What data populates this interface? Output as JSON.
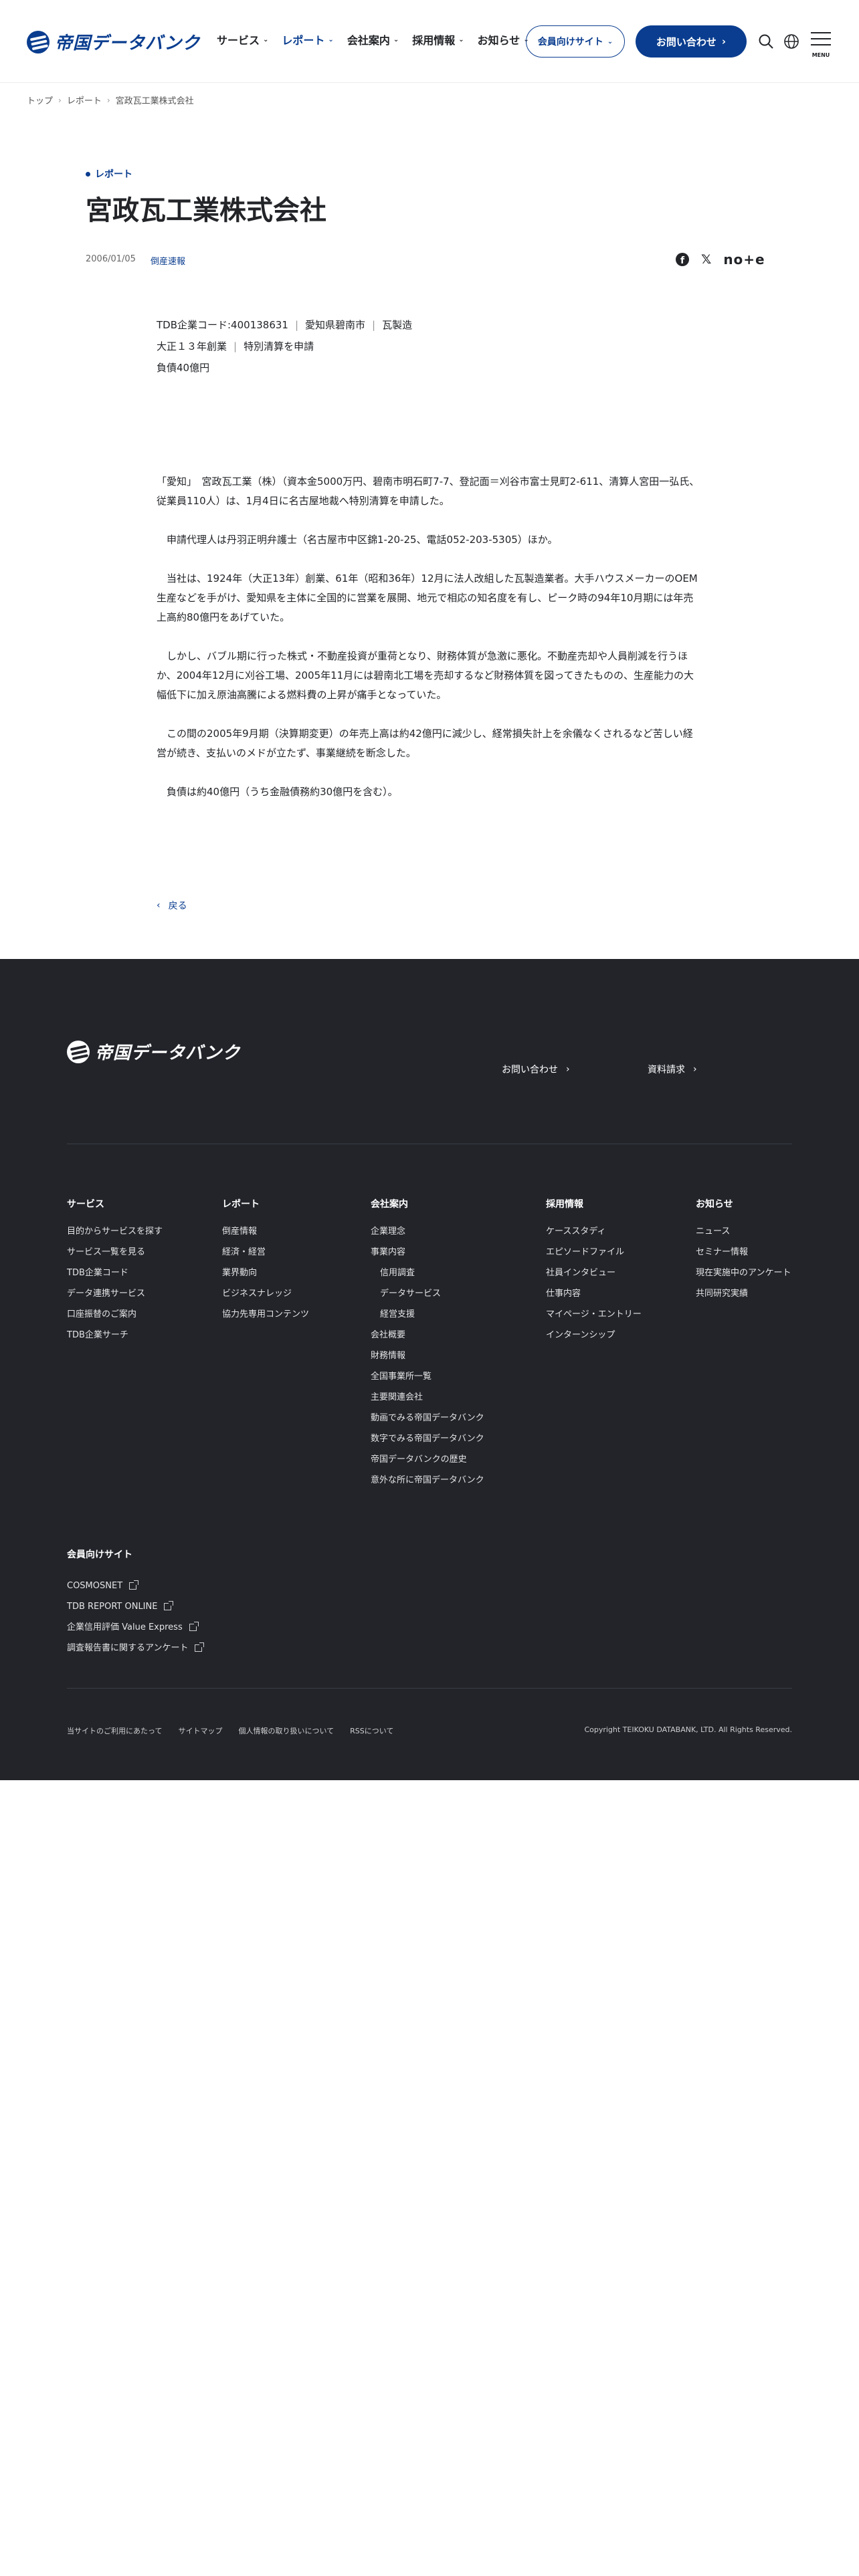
{
  "header": {
    "logo_text": "帝国データバンク",
    "nav": [
      "サービス",
      "レポート",
      "会社案内",
      "採用情報",
      "お知らせ"
    ],
    "active_nav": "レポート",
    "member_site_label": "会員向けサイト",
    "contact_label": "お問い合わせ",
    "menu_label": "MENU",
    "accent_color": "#0a3d8f"
  },
  "breadcrumb": [
    "トップ",
    "レポート",
    "宮政瓦工業株式会社"
  ],
  "article": {
    "category": "レポート",
    "title": "宮政瓦工業株式会社",
    "date": "2006/01/05",
    "tag": "倒産速報",
    "share": [
      "facebook-icon",
      "x-icon",
      "note-icon"
    ],
    "info_lines": [
      [
        "TDB企業コード:400138631",
        "愛知県碧南市",
        "瓦製造"
      ],
      [
        "大正１３年創業",
        "特別清算を申請"
      ],
      [
        "負債40億円"
      ]
    ],
    "paragraphs": [
      "「愛知」　宮政瓦工業（株）（資本金5000万円、碧南市明石町7-7、登記面＝刈谷市富士見町2-611、清算人宮田一弘氏、従業員110人）は、1月4日に名古屋地裁へ特別清算を申請した。",
      "　申請代理人は丹羽正明弁護士（名古屋市中区錦1-20-25、電話052-203-5305）ほか。",
      "　当社は、1924年（大正13年）創業、61年（昭和36年）12月に法人改組した瓦製造業者。大手ハウスメーカーのOEM生産などを手がけ、愛知県を主体に全国的に営業を展開、地元で相応の知名度を有し、ピーク時の94年10月期には年売上高約80億円をあげていた。",
      "　しかし、バブル期に行った株式・不動産投資が重荷となり、財務体質が急激に悪化。不動産売却や人員削減を行うほか、2004年12月に刈谷工場、2005年11月には碧南北工場を売却するなど財務体質を図ってきたものの、生産能力の大幅低下に加え原油高騰による燃料費の上昇が痛手となっていた。",
      "　この間の2005年9月期（決算期変更）の年売上高は約42億円に減少し、経常損失計上を余儀なくされるなど苦しい経営が続き、支払いのメドが立たず、事業継続を断念した。",
      "　負債は約40億円（うち金融債務約30億円を含む）。"
    ],
    "back_label": "戻る"
  },
  "footer": {
    "logo_text": "帝国データバンク",
    "top_links": [
      "お問い合わせ",
      "資料請求"
    ],
    "columns": [
      {
        "heading": "サービス",
        "items": [
          "目的からサービスを探す",
          "サービス一覧を見る",
          "TDB企業コード",
          "データ連携サービス",
          "口座振替のご案内",
          "TDB企業サーチ"
        ]
      },
      {
        "heading": "レポート",
        "items": [
          "倒産情報",
          "経済・経営",
          "業界動向",
          "ビジネスナレッジ",
          "協力先専用コンテンツ"
        ]
      },
      {
        "heading": "会社案内",
        "items": [
          "企業理念",
          "事業内容",
          "信用調査",
          "データサービス",
          "経営支援",
          "会社概要",
          "財務情報",
          "全国事業所一覧",
          "主要関連会社",
          "動画でみる帝国データバンク",
          "数字でみる帝国データバンク",
          "帝国データバンクの歴史",
          "意外な所に帝国データバンク"
        ]
      },
      {
        "heading": "採用情報",
        "items": [
          "ケーススタディ",
          "エピソードファイル",
          "社員インタビュー",
          "仕事内容",
          "マイページ・エントリー",
          "インターンシップ"
        ]
      },
      {
        "heading": "お知らせ",
        "items": [
          "ニュース",
          "セミナー情報",
          "現在実施中のアンケート",
          "共同研究実績"
        ]
      }
    ],
    "member_heading": "会員向けサイト",
    "member_links": [
      "COSMOSNET",
      "TDB REPORT ONLINE",
      "企業信用評価 Value Express",
      "調査報告書に関するアンケート"
    ],
    "legal_links": [
      "当サイトのご利用にあたって",
      "サイトマップ",
      "個人情報の取り扱いについて",
      "RSSについて"
    ],
    "copyright": "Copyright TEIKOKU DATABANK, LTD. All Rights Reserved.",
    "bg_color": "#22242a"
  }
}
